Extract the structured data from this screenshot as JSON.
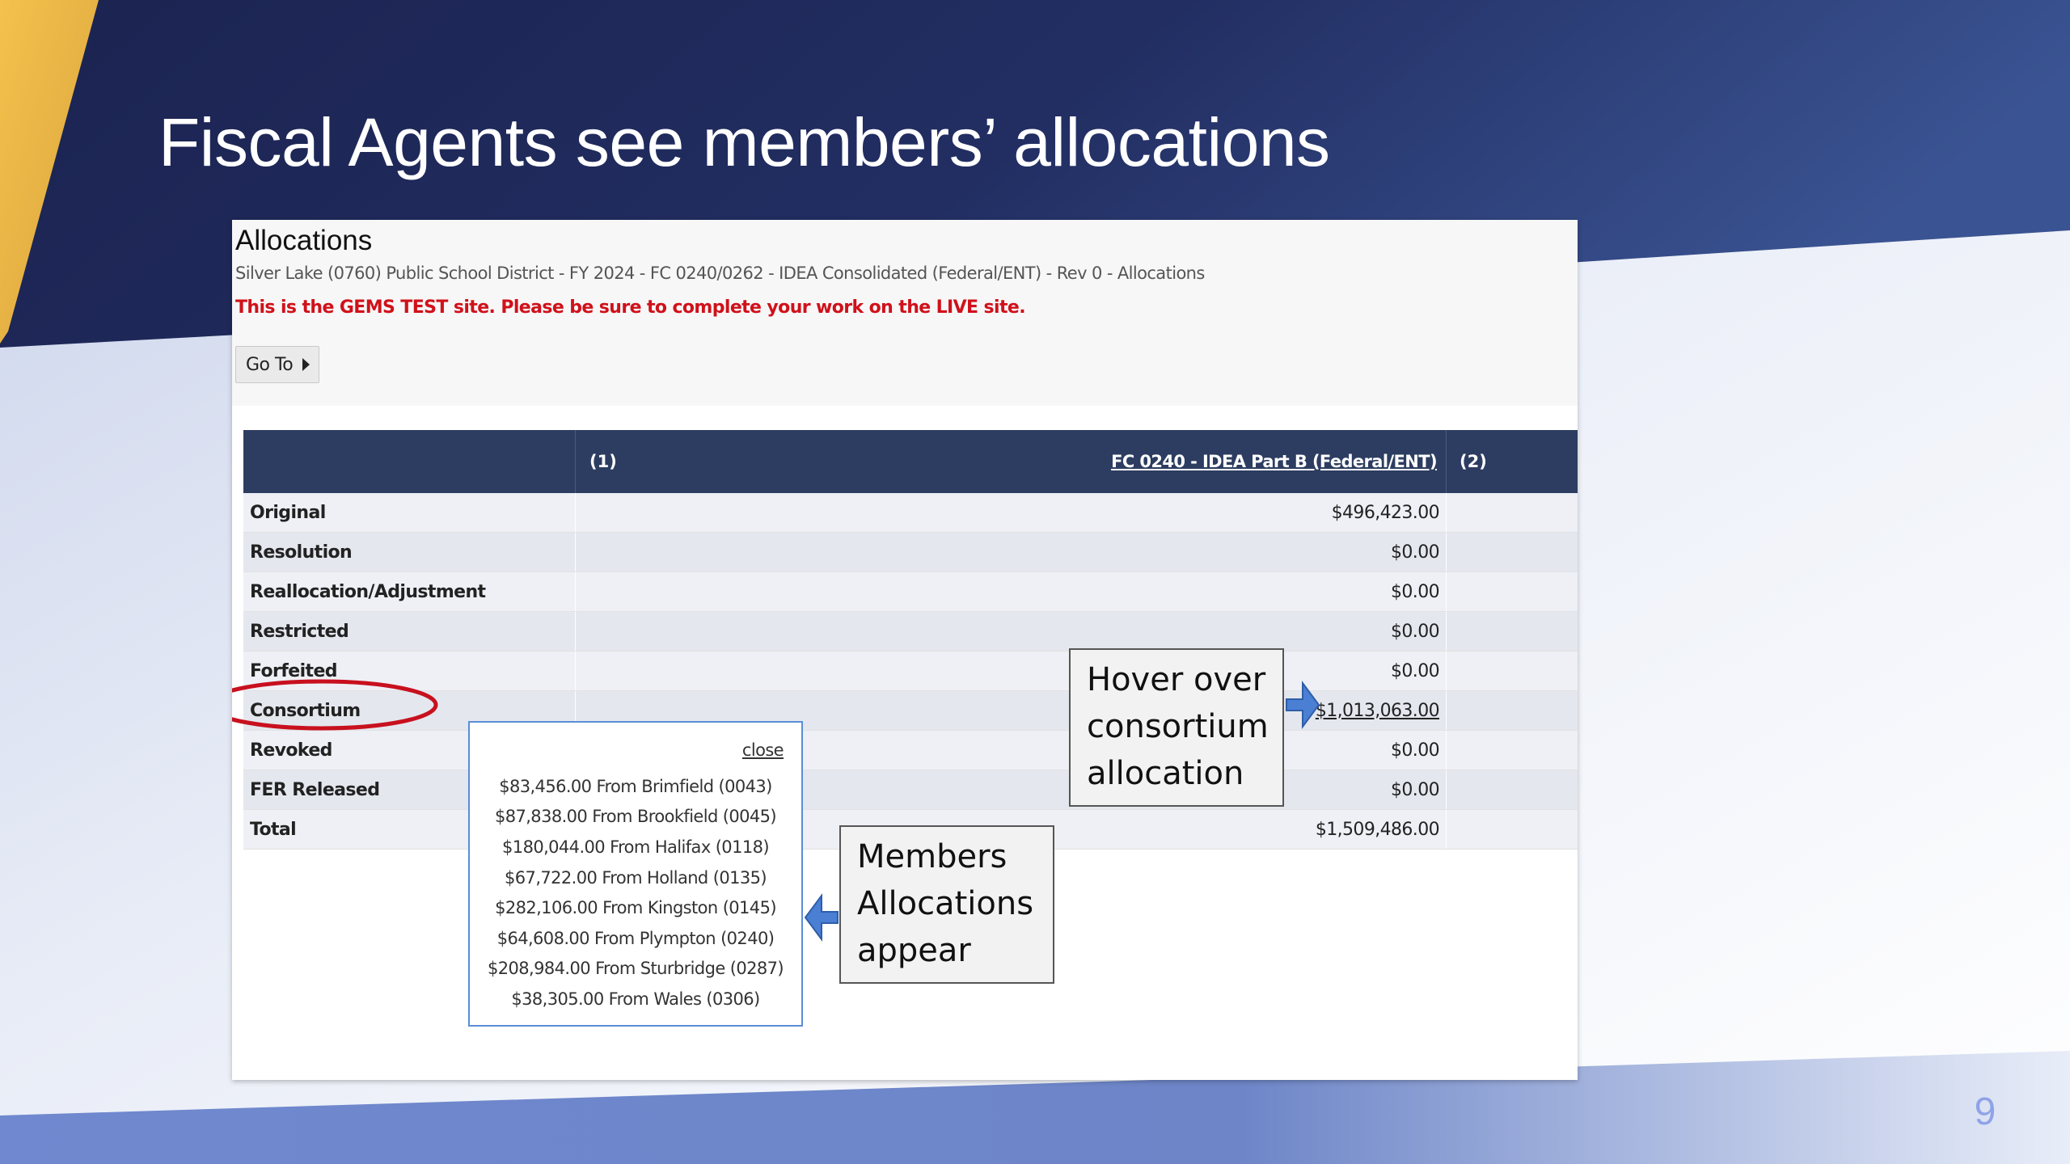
{
  "slide": {
    "title": "Fiscal Agents see members’ allocations",
    "page_number": "9"
  },
  "screen": {
    "heading": "Allocations",
    "breadcrumb": "Silver Lake (0760) Public School District - FY 2024 - FC 0240/0262 - IDEA Consolidated (Federal/ENT) - Rev 0 - Allocations",
    "warning": "This is the GEMS TEST site. Please be sure to complete your work on the LIVE site.",
    "goto_label": "Go To",
    "table": {
      "col1_num": "(1)",
      "col1_link": "FC 0240 - IDEA Part B (Federal/ENT)",
      "col2_num": "(2)",
      "rows": [
        {
          "label": "Original",
          "value": "$496,423.00"
        },
        {
          "label": "Resolution",
          "value": "$0.00"
        },
        {
          "label": "Reallocation/Adjustment",
          "value": "$0.00"
        },
        {
          "label": "Restricted",
          "value": "$0.00"
        },
        {
          "label": "Forfeited",
          "value": "$0.00"
        },
        {
          "label": "Consortium",
          "value": "$1,013,063.00"
        },
        {
          "label": "Revoked",
          "value": "$0.00"
        },
        {
          "label": "FER Released",
          "value": "$0.00"
        },
        {
          "label": "Total",
          "value": "$1,509,486.00"
        }
      ]
    },
    "popover": {
      "close_label": "close",
      "items": [
        "$83,456.00 From Brimfield (0043)",
        "$87,838.00 From Brookfield (0045)",
        "$180,044.00 From Halifax (0118)",
        "$67,722.00 From Holland (0135)",
        "$282,106.00 From Kingston (0145)",
        "$64,608.00 From Plympton (0240)",
        "$208,984.00 From Sturbridge (0287)",
        "$38,305.00 From Wales (0306)"
      ]
    }
  },
  "callouts": {
    "hover": [
      "Hover over",
      "consortium",
      "allocation"
    ],
    "members": [
      "Members",
      "Allocations",
      "appear"
    ]
  },
  "colors": {
    "navy": "#1c2752",
    "gold": "#f2bd48",
    "header_bar": "#2d3d61",
    "warning_red": "#d0111a",
    "arrow_blue": "#4a7fd4",
    "annotation_red": "#c8101e"
  },
  "icons": {
    "goto_caret": "caret-right-icon",
    "arrow_hover": "arrow-right-icon",
    "arrow_members": "arrow-left-icon",
    "consortium_ring": "annotation-ellipse"
  }
}
